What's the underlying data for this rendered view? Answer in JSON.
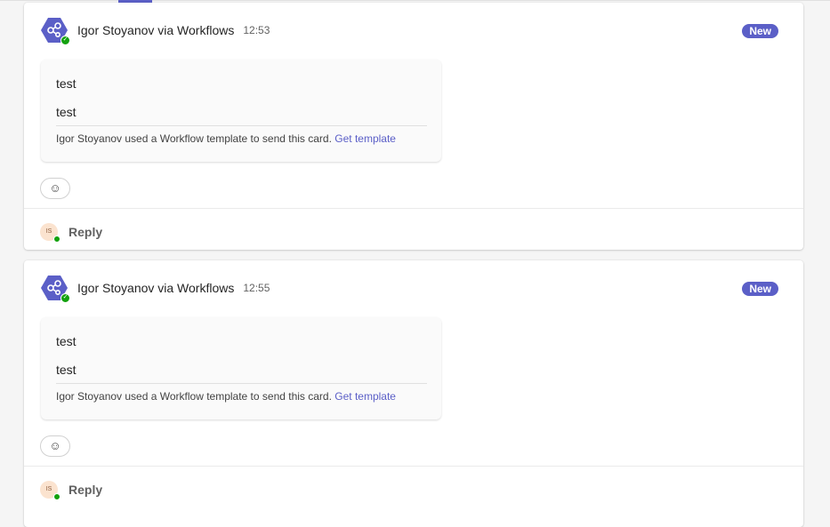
{
  "posts": [
    {
      "sender": "Igor Stoyanov via Workflows",
      "time": "12:53",
      "badge": "New",
      "lines": [
        "test",
        "test"
      ],
      "footer": "Igor Stoyanov used a Workflow template to send this card.",
      "footer_link": "Get template",
      "reply": "Reply",
      "avatar_initials": "IS"
    },
    {
      "sender": "Igor Stoyanov via Workflows",
      "time": "12:55",
      "badge": "New",
      "lines": [
        "test",
        "test"
      ],
      "footer": "Igor Stoyanov used a Workflow template to send this card.",
      "footer_link": "Get template",
      "reply": "Reply",
      "avatar_initials": "IS"
    }
  ],
  "colors": {
    "accent": "#5b5fc7",
    "presence": "#13a10e"
  }
}
